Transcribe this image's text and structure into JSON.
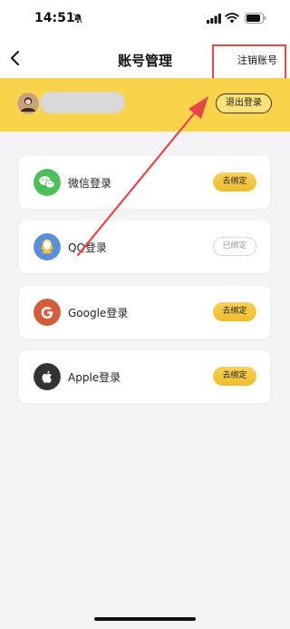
{
  "status_bar": {
    "time": "14:51"
  },
  "nav": {
    "title": "账号管理",
    "right_action": "注销账号"
  },
  "user_banner": {
    "logout_label": "退出登录"
  },
  "login_methods": [
    {
      "label": "微信登录",
      "button": "去绑定",
      "state": "unbound",
      "icon": "wechat-icon",
      "color": "#4cbf5a"
    },
    {
      "label": "QQ登录",
      "button": "已绑定",
      "state": "bound",
      "icon": "qq-icon",
      "color": "#5b8ed6"
    },
    {
      "label": "Google登录",
      "button": "去绑定",
      "state": "unbound",
      "icon": "google-icon",
      "color": "#d25d3e"
    },
    {
      "label": "Apple登录",
      "button": "去绑定",
      "state": "unbound",
      "icon": "apple-icon",
      "color": "#333333"
    }
  ],
  "colors": {
    "banner": "#f9d349",
    "annotation": "#e8474a",
    "button_active": "#efbc2c"
  }
}
